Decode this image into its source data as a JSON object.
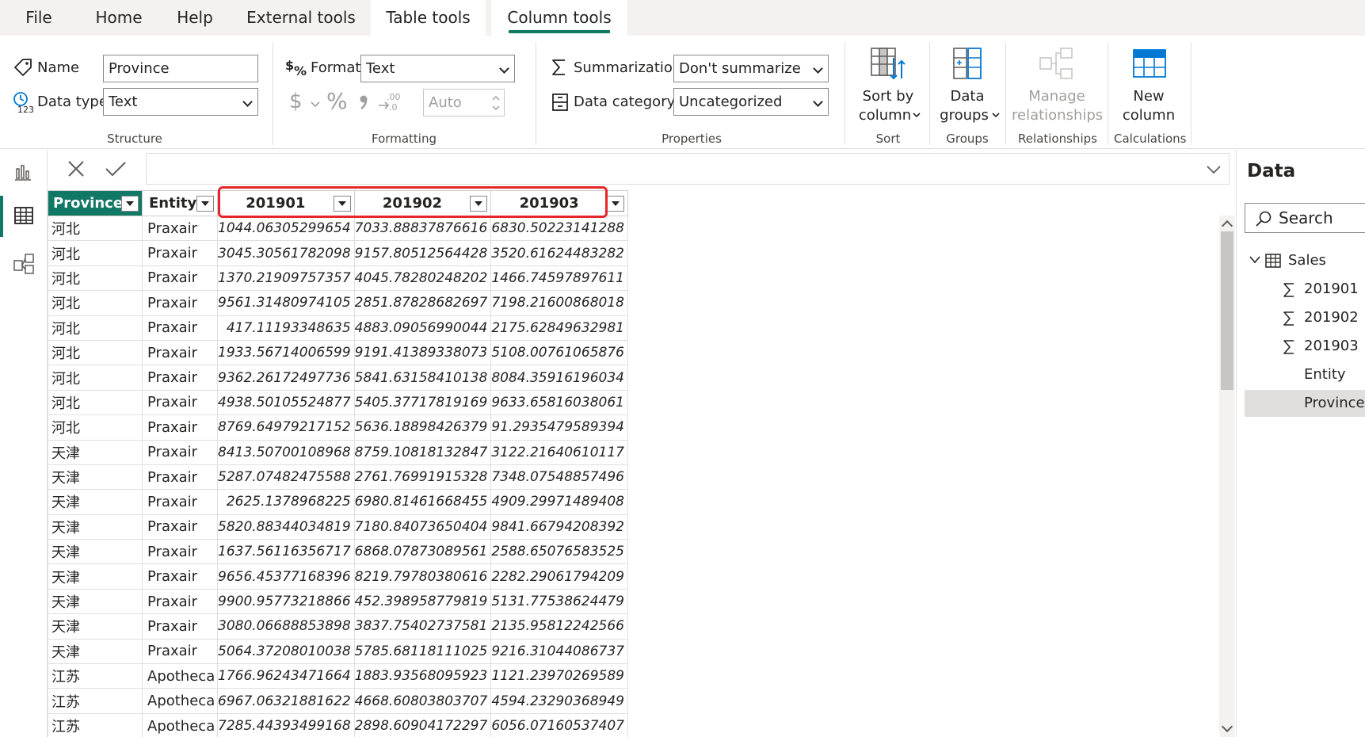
{
  "menu": {
    "items": [
      "File",
      "Home",
      "Help",
      "External tools",
      "Table tools",
      "Column tools"
    ],
    "active": "Column tools"
  },
  "ribbon": {
    "structure": {
      "name_label": "Name",
      "name_value": "Province",
      "datatype_label": "Data type",
      "datatype_value": "Text",
      "group": "Structure"
    },
    "formatting": {
      "format_label": "Format",
      "format_value": "Text",
      "currency_symbol": "$",
      "percent_symbol": "%",
      "decimals_value": "Auto",
      "group": "Formatting"
    },
    "properties": {
      "summarization_label": "Summarization",
      "summarization_value": "Don't summarize",
      "category_label": "Data category",
      "category_value": "Uncategorized",
      "group": "Properties"
    },
    "sort": {
      "line1": "Sort by",
      "line2": "column",
      "group": "Sort"
    },
    "groups": {
      "line1": "Data",
      "line2": "groups",
      "group": "Groups"
    },
    "relationships": {
      "line1": "Manage",
      "line2": "relationships",
      "group": "Relationships"
    },
    "calculations": {
      "line1": "New",
      "line2": "column",
      "group": "Calculations"
    }
  },
  "table": {
    "columns": [
      "Province",
      "Entity",
      "201901",
      "201902",
      "201903"
    ],
    "rows": [
      [
        "河北",
        "Praxair",
        "1044.06305299654",
        "7033.88837876616",
        "6830.50223141288"
      ],
      [
        "河北",
        "Praxair",
        "3045.30561782098",
        "9157.80512564428",
        "3520.61624483282"
      ],
      [
        "河北",
        "Praxair",
        "1370.21909757357",
        "4045.78280248202",
        "1466.74597897611"
      ],
      [
        "河北",
        "Praxair",
        "9561.31480974105",
        "2851.87828682697",
        "7198.21600868018"
      ],
      [
        "河北",
        "Praxair",
        "417.11193348635",
        "4883.09056990044",
        "2175.62849632981"
      ],
      [
        "河北",
        "Praxair",
        "1933.56714006599",
        "9191.41389338073",
        "5108.00761065876"
      ],
      [
        "河北",
        "Praxair",
        "9362.26172497736",
        "5841.63158410138",
        "8084.35916196034"
      ],
      [
        "河北",
        "Praxair",
        "4938.50105524877",
        "5405.37717819169",
        "9633.65816038061"
      ],
      [
        "河北",
        "Praxair",
        "8769.64979217152",
        "5636.18898426379",
        "91.2935479589394"
      ],
      [
        "天津",
        "Praxair",
        "8413.50700108968",
        "8759.10818132847",
        "3122.21640610117"
      ],
      [
        "天津",
        "Praxair",
        "5287.07482475588",
        "2761.76991915328",
        "7348.07548857496"
      ],
      [
        "天津",
        "Praxair",
        "2625.1378968225",
        "6980.81461668455",
        "4909.29971489408"
      ],
      [
        "天津",
        "Praxair",
        "5820.88344034819",
        "7180.84073650404",
        "9841.66794208392"
      ],
      [
        "天津",
        "Praxair",
        "1637.56116356717",
        "6868.07873089561",
        "2588.65076583525"
      ],
      [
        "天津",
        "Praxair",
        "9656.45377168396",
        "8219.79780380616",
        "2282.29061794209"
      ],
      [
        "天津",
        "Praxair",
        "9900.95773218866",
        "452.398958779819",
        "5131.77538624479"
      ],
      [
        "天津",
        "Praxair",
        "3080.06688853898",
        "3837.75402737581",
        "2135.95812242566"
      ],
      [
        "天津",
        "Praxair",
        "5064.37208010038",
        "5785.68118111025",
        "9216.31044086737"
      ],
      [
        "江苏",
        "Apotheca",
        "1766.96243471664",
        "1883.93568095923",
        "1121.23970269589"
      ],
      [
        "江苏",
        "Apotheca",
        "6967.06321881622",
        "4668.60803803707",
        "4594.23290368949"
      ],
      [
        "江苏",
        "Apotheca",
        "7285.44393499168",
        "2898.60904172297",
        "6056.07160537407"
      ]
    ]
  },
  "data_pane": {
    "title": "Data",
    "search_placeholder": "Search",
    "table_name": "Sales",
    "fields": [
      "201901",
      "201902",
      "201903",
      "Entity",
      "Province"
    ],
    "selected_field": "Province"
  },
  "colors": {
    "accent": "#117865",
    "highlight": "#e8262a"
  }
}
